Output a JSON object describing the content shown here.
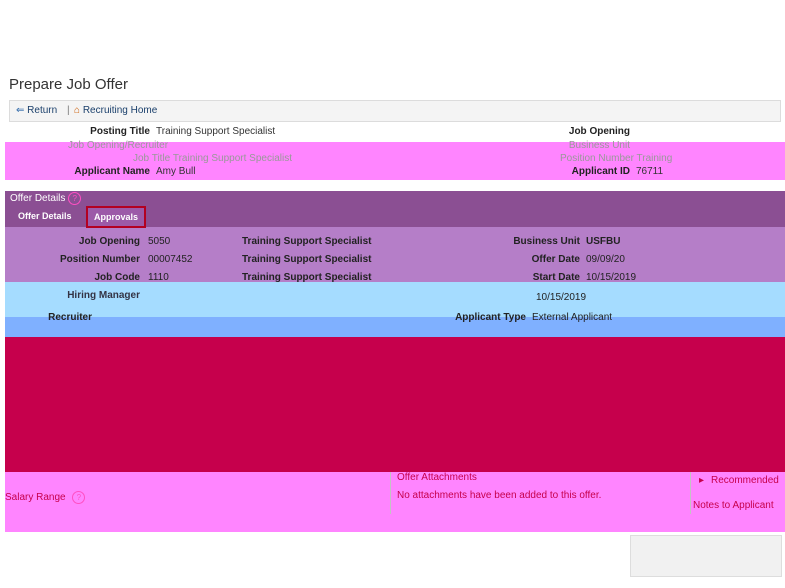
{
  "page": {
    "title": "Prepare Job Offer"
  },
  "nav": {
    "return_label": "Return",
    "separator": "|",
    "home_label": "Recruiting Home"
  },
  "posting": {
    "posting_title_label": "Posting Title",
    "posting_title_value": "Training Support Specialist",
    "recruiter_line": "Job Opening/Recruiter",
    "job_title_line": "Job Title  Training Support Specialist",
    "applicant_name_label": "Applicant Name",
    "applicant_name_value": "Amy Bull",
    "job_opening_label": "Job Opening",
    "business_unit_line": "Business Unit",
    "position_number_line": "Position Number  Training",
    "applicant_id_label": "Applicant ID",
    "applicant_id_value": "76711"
  },
  "offer_details": {
    "label": "Offer Details"
  },
  "tabs": {
    "offer_details": "Offer Details",
    "approvals": "Approvals"
  },
  "grid": {
    "job_opening_label": "Job Opening",
    "job_opening_value": "5050",
    "job_opening_title": "Training Support Specialist",
    "position_number_label": "Position Number",
    "position_number_value": "00007452",
    "position_number_title": "Training Support Specialist",
    "job_code_label": "Job Code",
    "job_code_value": "1110",
    "job_code_title": "Training Support Specialist",
    "business_unit_label": "Business Unit",
    "business_unit_value": "USFBU",
    "offer_date_label": "Offer Date",
    "offer_date_value": "09/09/20",
    "start_date_label": "Start Date",
    "start_date_value": "10/15/2019",
    "hiring_manager_label": "Hiring Manager",
    "expiration_value": "10/15/2019",
    "recruiter_label": "Recruiter",
    "applicant_type_label": "Applicant Type",
    "applicant_type_value": "External Applicant"
  },
  "lower": {
    "offer_attachments_label": "Offer Attachments",
    "no_attachments_text": "No attachments have been added to this offer.",
    "recommended_label": "Recommended",
    "salary_range_label": "Salary Range",
    "notes_label": "Notes to Applicant"
  },
  "colors": {
    "purple": "#8a4f92",
    "violet": "#b47ec8",
    "pink": "#ff84ff",
    "crimson": "#c6004c",
    "accent_box": "#b30022"
  }
}
